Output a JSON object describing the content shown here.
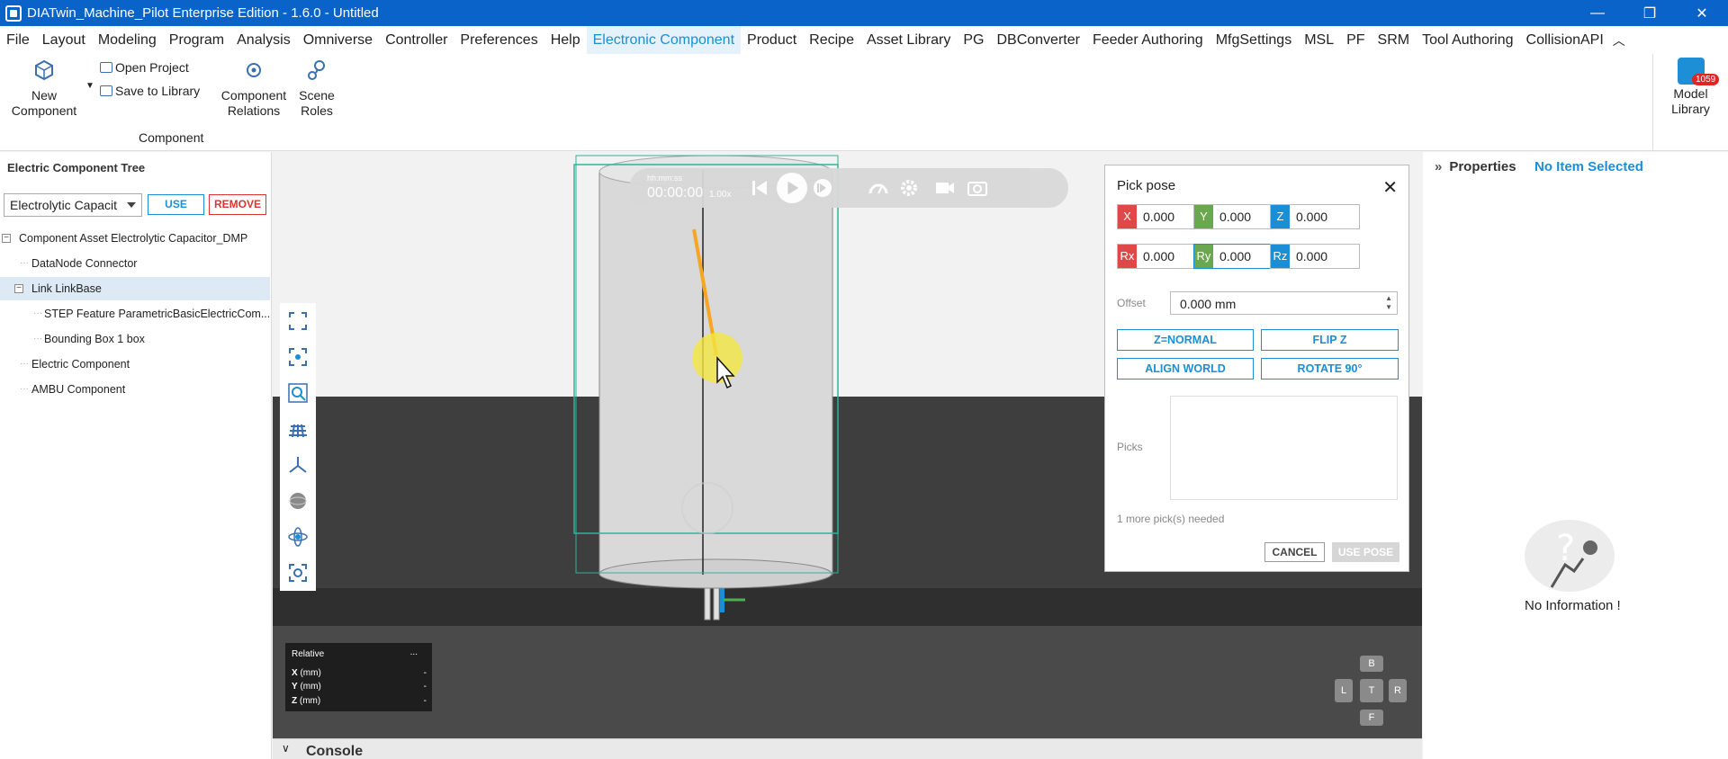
{
  "window": {
    "title": "DIATwin_Machine_Pilot Enterprise Edition - 1.6.0 - Untitled",
    "minimize": "—",
    "restore": "❐",
    "close": "✕"
  },
  "menu": [
    {
      "label": "File",
      "active": false
    },
    {
      "label": "Layout",
      "active": false
    },
    {
      "label": "Modeling",
      "active": false
    },
    {
      "label": "Program",
      "active": false
    },
    {
      "label": "Analysis",
      "active": false
    },
    {
      "label": "Omniverse",
      "active": false
    },
    {
      "label": "Controller",
      "active": false
    },
    {
      "label": "Preferences",
      "active": false
    },
    {
      "label": "Help",
      "active": false
    },
    {
      "label": "Electronic Component",
      "active": true
    },
    {
      "label": "Product",
      "active": false
    },
    {
      "label": "Recipe",
      "active": false
    },
    {
      "label": "Asset Library",
      "active": false
    },
    {
      "label": "PG",
      "active": false
    },
    {
      "label": "DBConverter",
      "active": false
    },
    {
      "label": "Feeder Authoring",
      "active": false
    },
    {
      "label": "MfgSettings",
      "active": false
    },
    {
      "label": "MSL",
      "active": false
    },
    {
      "label": "PF",
      "active": false
    },
    {
      "label": "SRM",
      "active": false
    },
    {
      "label": "Tool Authoring",
      "active": false
    },
    {
      "label": "CollisionAPI",
      "active": false
    }
  ],
  "ribbon": {
    "new_component": "New\nComponent",
    "new_component_l1": "New",
    "new_component_l2": "Component",
    "open_project": "Open Project",
    "save_to_library": "Save to Library",
    "component_relations_l1": "Component",
    "component_relations_l2": "Relations",
    "scene_roles_l1": "Scene",
    "scene_roles_l2": "Roles",
    "group_label": "Component",
    "model_library_l1": "Model",
    "model_library_l2": "Library",
    "model_library_badge": "1059"
  },
  "left_panel": {
    "title": "Electric Component Tree",
    "select_value": "Electrolytic Capacit",
    "use_label": "USE",
    "remove_label": "REMOVE",
    "tree": [
      {
        "label": "Component Asset  Electrolytic Capacitor_DMP",
        "toggle": "−",
        "selected": false
      },
      {
        "label": "DataNode  Connector",
        "toggle": "",
        "selected": false
      },
      {
        "label": "Link  LinkBase",
        "toggle": "−",
        "selected": true
      },
      {
        "label": "STEP Feature  ParametricBasicElectricCom...",
        "toggle": "",
        "selected": false
      },
      {
        "label": "Bounding Box  1 box",
        "toggle": "",
        "selected": false
      },
      {
        "label": "Electric Component",
        "toggle": "",
        "selected": false
      },
      {
        "label": "AMBU Component",
        "toggle": "",
        "selected": false
      }
    ]
  },
  "playback": {
    "time_label": "hh:mm:ss",
    "time": "00:00:00",
    "speed": "1.00x"
  },
  "pick_pose": {
    "title": "Pick pose",
    "coords": [
      {
        "tag": "X",
        "value": "0.000",
        "color": "#e04848"
      },
      {
        "tag": "Y",
        "value": "0.000",
        "color": "#6aa84f"
      },
      {
        "tag": "Z",
        "value": "0.000",
        "color": "#1a8fd6"
      },
      {
        "tag": "Rx",
        "value": "0.000",
        "color": "#e04848"
      },
      {
        "tag": "Ry",
        "value": "0.000",
        "color": "#6aa84f"
      },
      {
        "tag": "Rz",
        "value": "0.000",
        "color": "#1a8fd6"
      }
    ],
    "offset_label": "Offset",
    "offset_value": "0.000 mm",
    "btn_z_normal": "Z=NORMAL",
    "btn_flip_z": "FLIP Z",
    "btn_align_world": "ALIGN WORLD",
    "btn_rotate_90": "ROTATE 90°",
    "picks_label": "Picks",
    "picks_needed": "1 more pick(s) needed",
    "cancel": "CANCEL",
    "use_pose": "USE POSE"
  },
  "relative_box": {
    "title": "Relative",
    "more": "...",
    "rows": [
      {
        "axis": "X",
        "unit": " (mm)",
        "value": "-"
      },
      {
        "axis": "Y",
        "unit": " (mm)",
        "value": "-"
      },
      {
        "axis": "Z",
        "unit": " (mm)",
        "value": "-"
      }
    ]
  },
  "view_cube": {
    "top": "B",
    "left": "L",
    "center": "T",
    "right": "R",
    "bottom": "F"
  },
  "properties": {
    "title": "Properties",
    "status": "No Item Selected",
    "no_info": "No Information !"
  },
  "console": {
    "label": "Console"
  },
  "colors": {
    "accent": "#1a8fd6",
    "titlebar": "#0a63c9",
    "remove": "#d33333",
    "bbox": "#2fb39b",
    "pick_line": "#f5a623"
  }
}
